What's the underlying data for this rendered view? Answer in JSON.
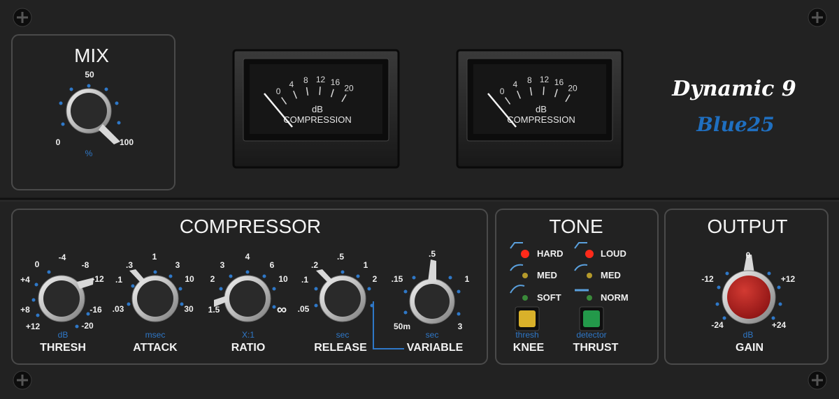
{
  "brand": {
    "name": "Dynamic 9",
    "model": "Blue25",
    "model_color": "#1f6fc0"
  },
  "mix": {
    "title": "MIX",
    "scale": {
      "min": "0",
      "mid": "50",
      "max": "100"
    },
    "unit": "%",
    "value_percent": 100
  },
  "meters": [
    {
      "scale": [
        "0",
        "4",
        "8",
        "12",
        "16",
        "20"
      ],
      "caption_unit": "dB",
      "caption": "COMPRESSION",
      "value_db": 0
    },
    {
      "scale": [
        "0",
        "4",
        "8",
        "12",
        "16",
        "20"
      ],
      "caption_unit": "dB",
      "caption": "COMPRESSION",
      "value_db": 0
    }
  ],
  "compressor": {
    "title": "COMPRESSOR",
    "thresh": {
      "label": "THRESH",
      "unit": "dB",
      "scale": [
        "+12",
        "+8",
        "+4",
        "0",
        "-4",
        "-8",
        "-12",
        "-16",
        "-20"
      ]
    },
    "attack": {
      "label": "ATTACK",
      "unit": "msec",
      "scale": [
        ".03",
        ".1",
        ".3",
        "1",
        "3",
        "10",
        "30"
      ]
    },
    "ratio": {
      "label": "RATIO",
      "unit": "X:1",
      "scale": [
        "1.5",
        "2",
        "3",
        "4",
        "6",
        "10",
        "∞"
      ]
    },
    "release": {
      "label": "RELEASE",
      "unit": "sec",
      "scale": [
        ".05",
        ".1",
        ".2",
        ".5",
        "1",
        "2"
      ]
    },
    "variable": {
      "label": "VARIABLE",
      "unit": "sec",
      "scale": [
        "50m",
        ".15",
        ".5",
        "1",
        "3"
      ]
    }
  },
  "tone": {
    "title": "TONE",
    "knee": {
      "label": "KNEE",
      "sublabel": "thresh",
      "options": [
        "HARD",
        "MED",
        "SOFT"
      ],
      "selected": "HARD",
      "button_color": "#d9b12a"
    },
    "thrust": {
      "label": "THRUST",
      "sublabel": "detector",
      "options": [
        "LOUD",
        "MED",
        "NORM"
      ],
      "selected": "LOUD",
      "button_color": "#23994a"
    }
  },
  "output": {
    "title": "OUTPUT",
    "gain": {
      "label": "GAIN",
      "unit": "dB",
      "scale": [
        "-24",
        "-12",
        "0",
        "+12",
        "+24"
      ],
      "value_db": 0,
      "knob_color": "#b3201f"
    }
  },
  "colors": {
    "accent_blue": "#2f78c8",
    "led_red": "#ff2a1a",
    "led_olive": "#b59a2b",
    "led_green": "#3a8a3a"
  }
}
